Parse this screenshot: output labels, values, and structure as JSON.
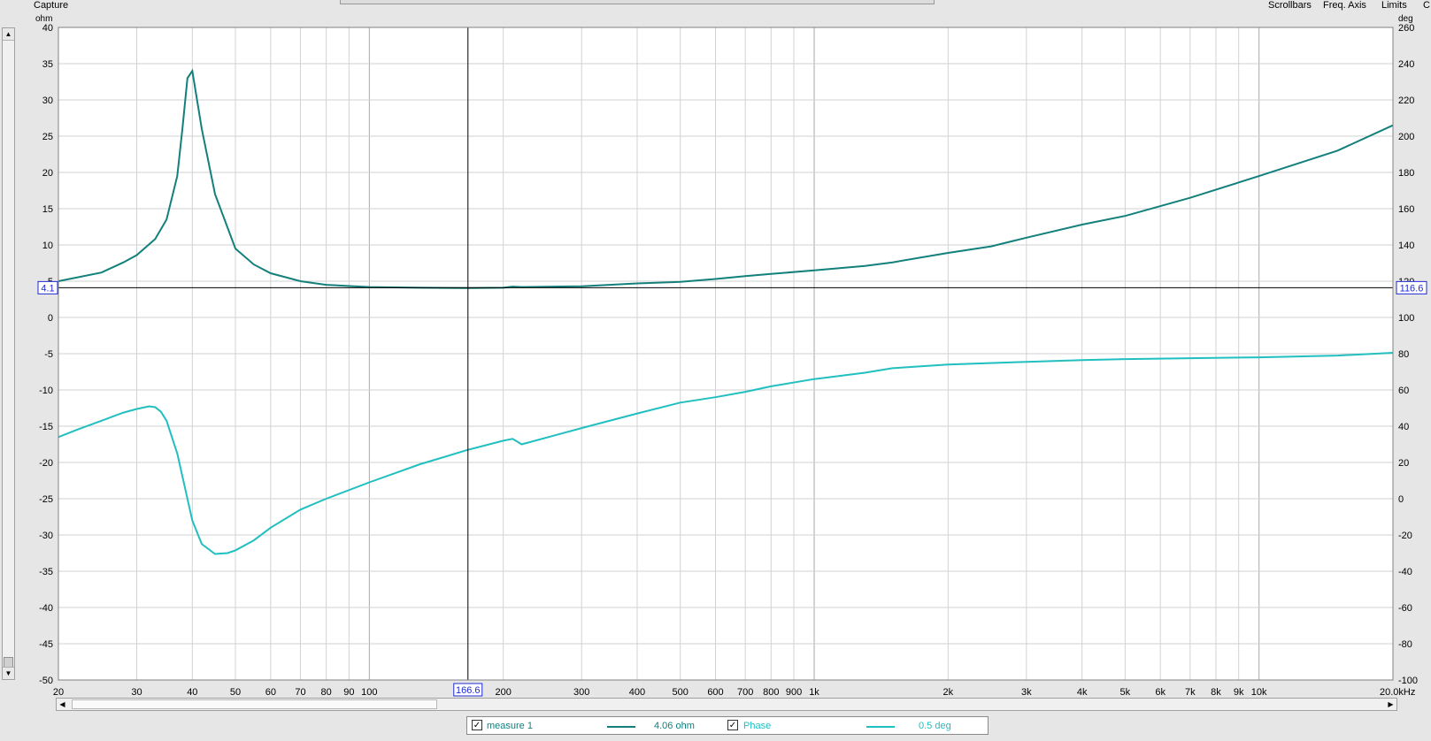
{
  "header": {
    "capture_label": "Capture",
    "buttons": [
      "Scrollbars",
      "Freq. Axis",
      "Limits",
      "C"
    ],
    "left_unit": "ohm",
    "right_unit": "deg"
  },
  "cursor": {
    "freq_label": "166.6",
    "left_value": "4.1",
    "right_value": "116.6",
    "freq_hz": 166.6,
    "impedance_ohm": 4.1,
    "phase_deg": 116.6
  },
  "legend": {
    "measure_name": "measure 1",
    "measure_value": "4.06 ohm",
    "phase_name": "Phase",
    "phase_value": "0.5 deg",
    "measure_checked": "✓",
    "phase_checked": "✓"
  },
  "colors": {
    "impedance": "#13807c",
    "phase": "#21bfc0",
    "grid": "#d2d2d2",
    "grid_major": "#a8a8a8",
    "plot_bg": "#ffffff",
    "cursor_label": "#1f2ad1"
  },
  "chart_data": {
    "type": "line",
    "x_scale": "log",
    "xlim": [
      20,
      20000
    ],
    "ylim_left": [
      -50,
      40
    ],
    "ylim_right": [
      -100,
      260
    ],
    "left_ticks": [
      40,
      35,
      30,
      25,
      20,
      15,
      10,
      5,
      0,
      -5,
      -10,
      -15,
      -20,
      -25,
      -30,
      -35,
      -40,
      -45,
      -50
    ],
    "right_ticks": [
      260,
      240,
      220,
      200,
      180,
      160,
      140,
      120,
      100,
      80,
      60,
      40,
      20,
      0,
      -20,
      -40,
      -60,
      -80,
      -100
    ],
    "x_tick_labels": [
      {
        "v": 20,
        "t": "20"
      },
      {
        "v": 30,
        "t": "30"
      },
      {
        "v": 40,
        "t": "40"
      },
      {
        "v": 50,
        "t": "50"
      },
      {
        "v": 60,
        "t": "60"
      },
      {
        "v": 70,
        "t": "70"
      },
      {
        "v": 80,
        "t": "80"
      },
      {
        "v": 90,
        "t": "90"
      },
      {
        "v": 100,
        "t": "100"
      },
      {
        "v": 200,
        "t": "200"
      },
      {
        "v": 300,
        "t": "300"
      },
      {
        "v": 400,
        "t": "400"
      },
      {
        "v": 500,
        "t": "500"
      },
      {
        "v": 600,
        "t": "600"
      },
      {
        "v": 700,
        "t": "700"
      },
      {
        "v": 800,
        "t": "800"
      },
      {
        "v": 900,
        "t": "900"
      },
      {
        "v": 1000,
        "t": "1k"
      },
      {
        "v": 2000,
        "t": "2k"
      },
      {
        "v": 3000,
        "t": "3k"
      },
      {
        "v": 4000,
        "t": "4k"
      },
      {
        "v": 5000,
        "t": "5k"
      },
      {
        "v": 6000,
        "t": "6k"
      },
      {
        "v": 7000,
        "t": "7k"
      },
      {
        "v": 8000,
        "t": "8k"
      },
      {
        "v": 9000,
        "t": "9k"
      },
      {
        "v": 10000,
        "t": "10k"
      },
      {
        "v": 20000,
        "t": "20.0kHz"
      }
    ],
    "series": [
      {
        "name": "measure 1",
        "axis": "left",
        "x": [
          20,
          25,
          28,
          30,
          33,
          35,
          37,
          38,
          39,
          40,
          42,
          45,
          50,
          55,
          60,
          70,
          80,
          100,
          130,
          166.6,
          200,
          210,
          220,
          300,
          400,
          500,
          600,
          700,
          800,
          1000,
          1300,
          1500,
          2000,
          2500,
          3000,
          4000,
          5000,
          7000,
          10000,
          15000,
          20000
        ],
        "y": [
          5,
          6.2,
          7.6,
          8.6,
          10.8,
          13.5,
          19.5,
          26,
          33,
          34,
          26,
          17,
          9.5,
          7.3,
          6.1,
          5,
          4.5,
          4.2,
          4.1,
          4.06,
          4.1,
          4.25,
          4.2,
          4.3,
          4.7,
          4.9,
          5.3,
          5.7,
          6.0,
          6.5,
          7.1,
          7.6,
          8.9,
          9.8,
          11,
          12.8,
          14,
          16.5,
          19.5,
          23,
          26.5
        ]
      },
      {
        "name": "Phase",
        "axis": "right",
        "x": [
          20,
          22,
          25,
          28,
          30,
          32,
          33,
          34,
          35,
          37,
          40,
          42,
          45,
          48,
          50,
          55,
          60,
          70,
          80,
          100,
          130,
          166.6,
          200,
          210,
          220,
          300,
          400,
          500,
          600,
          700,
          800,
          1000,
          1300,
          1500,
          2000,
          3000,
          4000,
          5000,
          7000,
          10000,
          15000,
          20000
        ],
        "y": [
          34,
          38,
          43,
          47.5,
          49.5,
          51,
          50.5,
          48,
          43,
          25,
          -12,
          -25,
          -30.5,
          -30,
          -28.5,
          -23,
          -16,
          -6,
          0,
          9,
          19,
          27,
          32,
          33,
          30,
          39,
          47,
          53,
          56,
          59,
          62,
          66,
          69.5,
          72,
          74,
          75.5,
          76.5,
          77,
          77.5,
          78,
          79,
          80.5
        ]
      }
    ]
  }
}
